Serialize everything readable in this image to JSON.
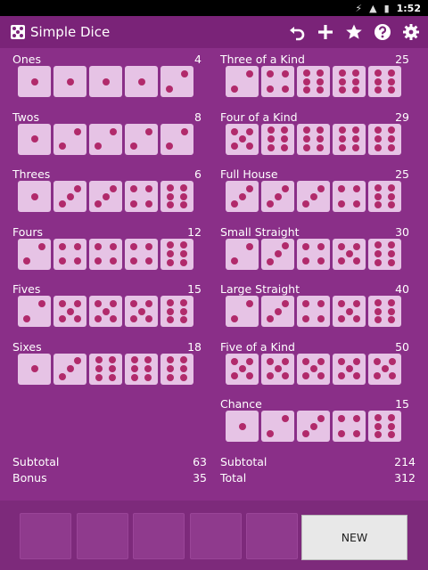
{
  "status": {
    "time": "1:52"
  },
  "app": {
    "title": "Simple Dice"
  },
  "actions": [
    {
      "name": "undo",
      "icon": "undo-icon"
    },
    {
      "name": "add",
      "icon": "plus-icon"
    },
    {
      "name": "favorite",
      "icon": "star-icon"
    },
    {
      "name": "help",
      "icon": "help-icon"
    },
    {
      "name": "settings",
      "icon": "gear-icon"
    }
  ],
  "colors": {
    "background": "#8a2f88",
    "die_face": "#e6c3e5",
    "pip": "#b12a6b"
  },
  "upper": [
    {
      "name": "Ones",
      "score": "4",
      "dice": [
        1,
        1,
        1,
        1,
        2
      ]
    },
    {
      "name": "Twos",
      "score": "8",
      "dice": [
        1,
        2,
        2,
        2,
        2
      ]
    },
    {
      "name": "Threes",
      "score": "6",
      "dice": [
        1,
        3,
        3,
        4,
        6
      ]
    },
    {
      "name": "Fours",
      "score": "12",
      "dice": [
        2,
        4,
        4,
        4,
        6
      ]
    },
    {
      "name": "Fives",
      "score": "15",
      "dice": [
        2,
        5,
        5,
        5,
        6
      ]
    },
    {
      "name": "Sixes",
      "score": "18",
      "dice": [
        1,
        3,
        6,
        6,
        6
      ]
    }
  ],
  "lower": [
    {
      "name": "Three of a Kind",
      "score": "25",
      "dice": [
        2,
        4,
        6,
        6,
        6
      ]
    },
    {
      "name": "Four of a Kind",
      "score": "29",
      "dice": [
        5,
        6,
        6,
        6,
        6
      ]
    },
    {
      "name": "Full House",
      "score": "25",
      "dice": [
        3,
        3,
        3,
        4,
        6
      ]
    },
    {
      "name": "Small Straight",
      "score": "30",
      "dice": [
        2,
        3,
        4,
        5,
        6
      ]
    },
    {
      "name": "Large Straight",
      "score": "40",
      "dice": [
        2,
        3,
        4,
        5,
        6
      ]
    },
    {
      "name": "Five of a Kind",
      "score": "50",
      "dice": [
        5,
        5,
        5,
        5,
        5
      ]
    },
    {
      "name": "Chance",
      "score": "15",
      "dice": [
        1,
        2,
        3,
        4,
        6
      ]
    }
  ],
  "upper_totals": {
    "subtotal_label": "Subtotal",
    "subtotal": "63",
    "bonus_label": "Bonus",
    "bonus": "35"
  },
  "lower_totals": {
    "subtotal_label": "Subtotal",
    "subtotal": "214",
    "total_label": "Total",
    "total": "312"
  },
  "tray": {
    "slots": 5,
    "new_label": "NEW"
  }
}
